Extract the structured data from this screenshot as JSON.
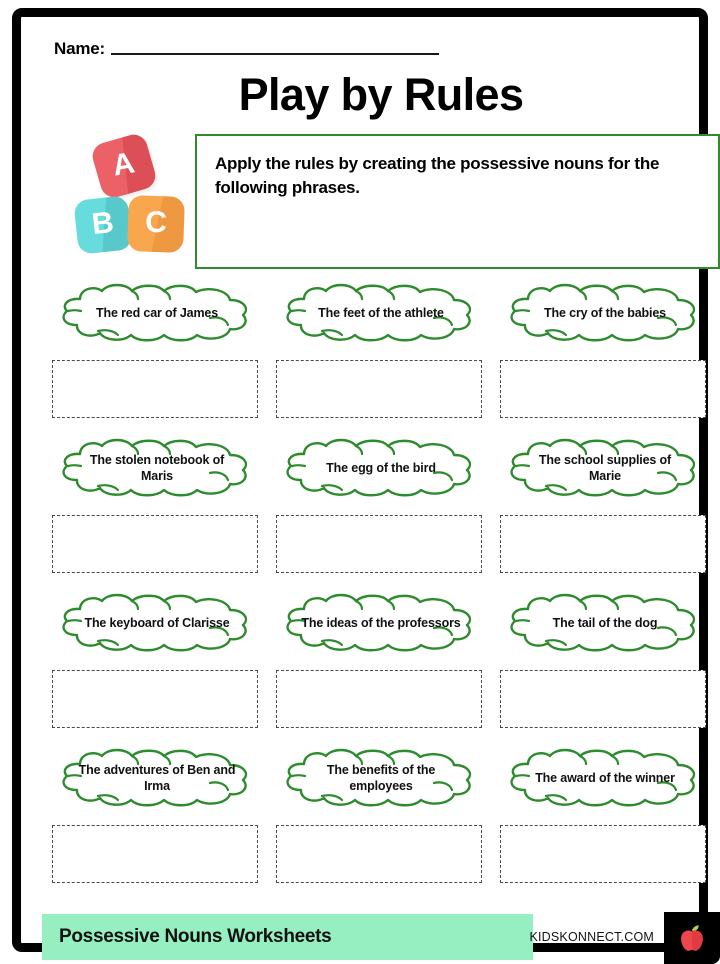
{
  "header": {
    "name_label": "Name:",
    "title": "Play by Rules"
  },
  "blocks": [
    {
      "letter": "A",
      "color": "#EC6068",
      "name": "block-a"
    },
    {
      "letter": "B",
      "color": "#68DCDC",
      "name": "block-b"
    },
    {
      "letter": "C",
      "color": "#F9A74F",
      "name": "block-c"
    }
  ],
  "instructions": {
    "text": "Apply the rules by creating the possessive nouns for the following phrases.",
    "border_color": "#2E8B2E"
  },
  "exercises": {
    "cloud_stroke_color": "#2E8B2E",
    "answer_box_border_color": "#4a4a4a",
    "rows": [
      [
        {
          "prompt": "The red car of James",
          "answer": ""
        },
        {
          "prompt": "The feet of the athlete",
          "answer": ""
        },
        {
          "prompt": "The cry of the babies",
          "answer": ""
        }
      ],
      [
        {
          "prompt": "The stolen notebook of Maris",
          "answer": ""
        },
        {
          "prompt": "The egg of the bird",
          "answer": ""
        },
        {
          "prompt": "The school supplies of Marie",
          "answer": ""
        }
      ],
      [
        {
          "prompt": "The keyboard of Clarisse",
          "answer": ""
        },
        {
          "prompt": "The ideas of the professors",
          "answer": ""
        },
        {
          "prompt": "The tail of the dog",
          "answer": ""
        }
      ],
      [
        {
          "prompt": "The adventures of Ben and Irma",
          "answer": ""
        },
        {
          "prompt": "The benefits of the employees",
          "answer": ""
        },
        {
          "prompt": "The award of the winner",
          "answer": ""
        }
      ]
    ]
  },
  "footer": {
    "title": "Possessive Nouns Worksheets",
    "url": "KIDSKONNECT.COM",
    "band_color": "#96EFC0",
    "logo_icon": "apple-icon"
  }
}
